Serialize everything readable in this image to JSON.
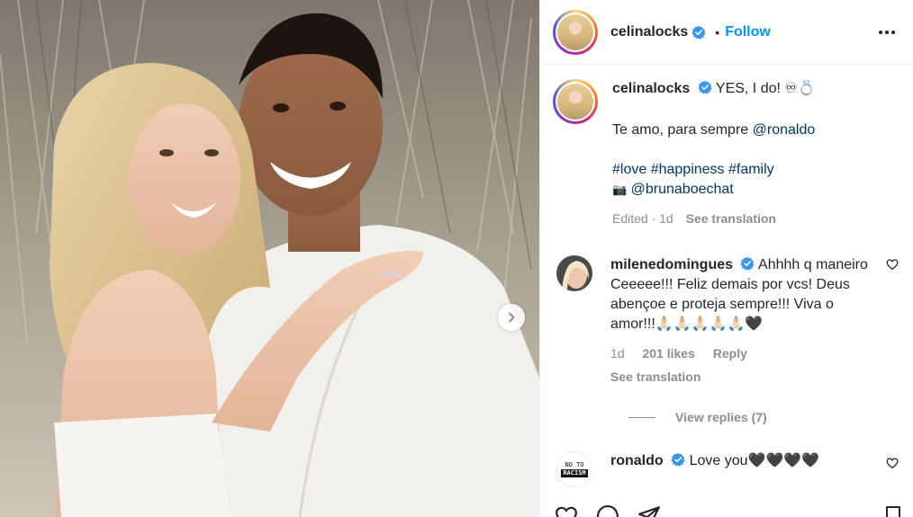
{
  "post": {
    "username": "celinalocks",
    "follow_label": "Follow",
    "separator": "•"
  },
  "caption": {
    "username": "celinalocks",
    "line1": "YES, I do! ♾💍",
    "line2_text": "Te amo, para sempre ",
    "line2_mention": "@ronaldo",
    "hashtags": "#love #happiness #family",
    "camera_glyph": "📷",
    "credit": "@brunaboechat",
    "edited": "Edited · 1d",
    "see_translation": "See translation"
  },
  "comments": [
    {
      "username": "milenedomingues",
      "text": "Ahhhh q maneiro Ceeeee!!! Feliz demais por vcs! Deus abençoe e proteja sempre!!! Viva o amor!!!🙏🏻🙏🏻🙏🏻🙏🏻🙏🏻🖤",
      "time": "1d",
      "likes": "201 likes",
      "reply": "Reply",
      "see_translation": "See translation",
      "view_replies": "View replies (7)"
    },
    {
      "username": "ronaldo",
      "text": "Love you🖤🖤🖤🖤",
      "avatar_text_top": "NO TO",
      "avatar_text_bottom": "RACISM"
    }
  ],
  "icons": {
    "verified": "verified-badge-icon",
    "more": "more-options-icon",
    "heart": "heart-icon",
    "next": "chevron-right-icon",
    "comment": "comment-icon",
    "share": "share-icon",
    "save": "bookmark-icon"
  },
  "colors": {
    "accent": "#0095f6",
    "link": "#00376b",
    "muted": "#8e8e8e",
    "verified": "#3897f0"
  }
}
